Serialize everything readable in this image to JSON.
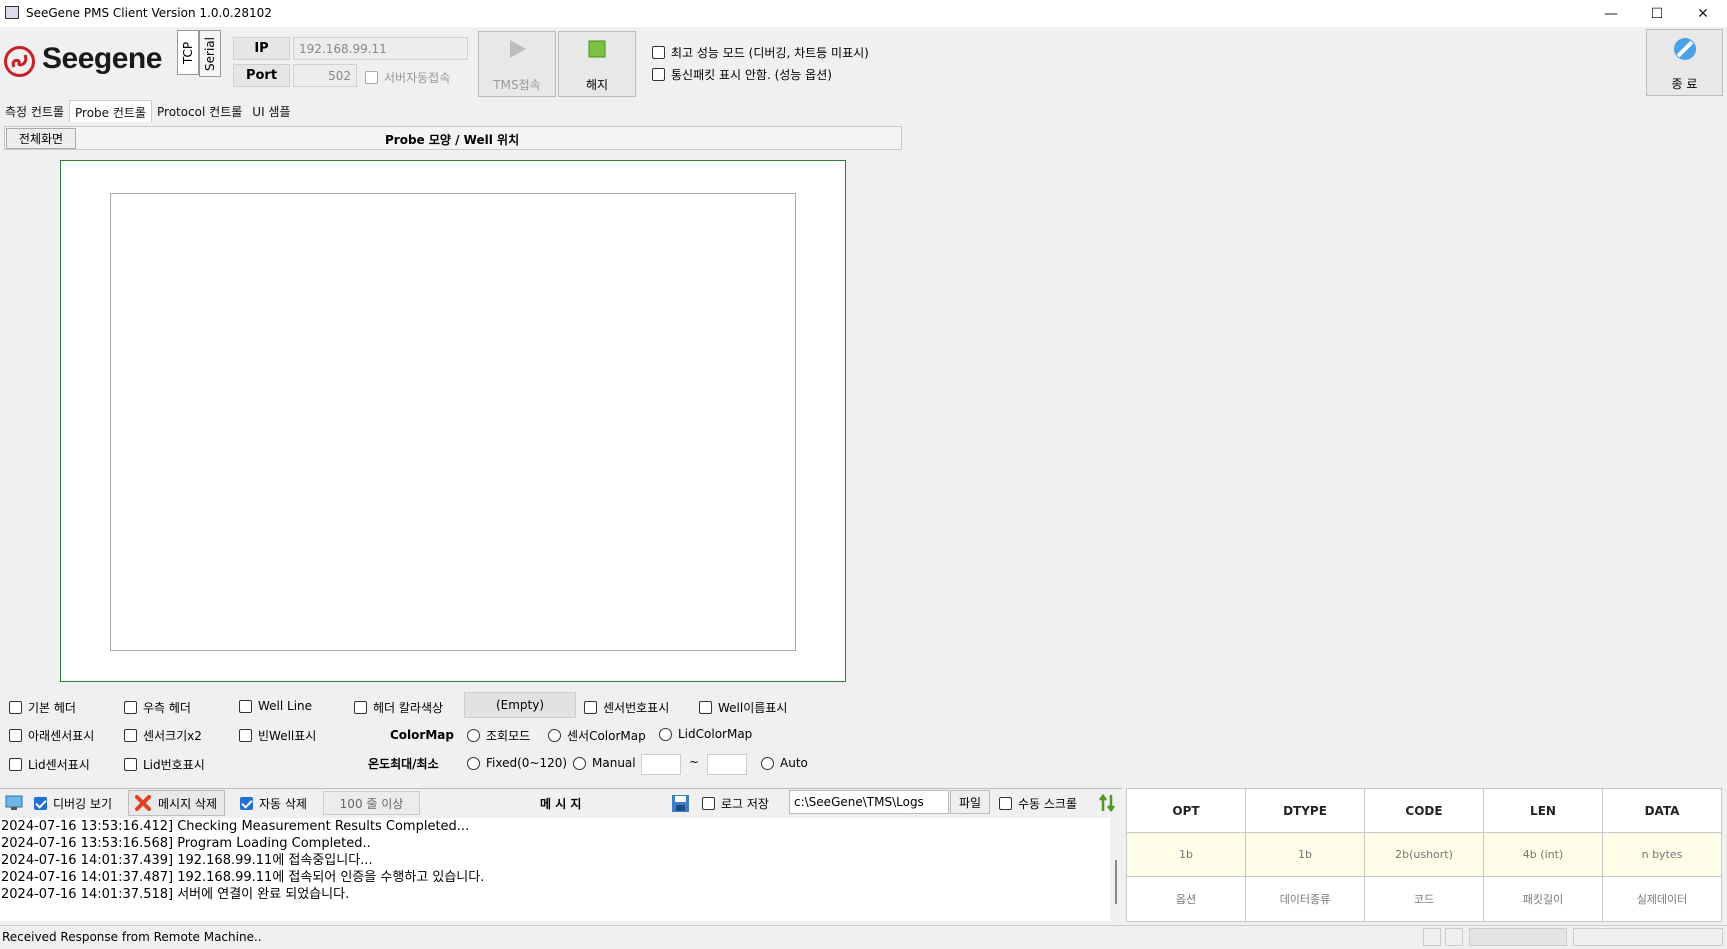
{
  "window": {
    "title": "SeeGene PMS Client Version 1.0.0.28102",
    "controls": [
      "—",
      "☐",
      "✕"
    ]
  },
  "toolbar": {
    "logo_text": "Seegene",
    "conn_tabs": [
      "TCP",
      "Serial"
    ],
    "ip_label": "IP",
    "ip_value": "192.168.99.11",
    "port_label": "Port",
    "port_value": "502",
    "auto_connect_label": "서버자동접속",
    "connect_label": "TMS접속",
    "disconnect_label": "해지",
    "max_perf_label": "최고 성능 모드 (디버깅, 차트등 미표시)",
    "hide_packet_label": "통신패킷 표시 안함. (성능 옵션)",
    "exit_label": "종 료"
  },
  "tabs": [
    "측정 컨트롤",
    "Probe 컨트롤",
    "Protocol 컨트롤",
    "UI 샘플"
  ],
  "probe": {
    "fullscreen_label": "전체화면",
    "title": "Probe 모양 / Well 위치",
    "options_row1": [
      "기본 헤더",
      "우측 헤더",
      "Well Line",
      "헤더 칼라색상"
    ],
    "empty_label": "(Empty)",
    "options_row1b": [
      "센서번호표시",
      "Well이름표시"
    ],
    "options_row2": [
      "아래센서표시",
      "센서크기x2",
      "빈Well표시"
    ],
    "colormap_label": "ColorMap",
    "colormap_options": [
      "조회모드",
      "센서ColorMap",
      "LidColorMap"
    ],
    "options_row3": [
      "Lid센서표시",
      "Lid번호표시"
    ],
    "temp_label": "온도최대/최소",
    "temp_options": [
      "Fixed(0~120)",
      "Manual"
    ],
    "tilde": "~",
    "auto_label": "Auto"
  },
  "log": {
    "debug_view_label": "디버깅 보기",
    "delete_msg_label": "메시지 삭제",
    "auto_delete_label": "자동 삭제",
    "lines_label": "100 줄 이상",
    "title": "메 시 지",
    "save_log_label": "로그 저장",
    "path_value": "c:\\SeeGene\\TMS\\Logs",
    "file_label": "파일",
    "manual_scroll_label": "수동 스크롤",
    "lines": [
      "2024-07-16 13:53:16.412] Checking Measurement Results Completed...",
      "2024-07-16 13:53:16.568] Program Loading Completed..",
      "2024-07-16 14:01:37.439] 192.168.99.11에 접속중입니다...",
      "2024-07-16 14:01:37.487] 192.168.99.11에 접속되어 인증을 수행하고 있습니다.",
      "2024-07-16 14:01:37.518] 서버에 연결이 완료 되었습니다."
    ]
  },
  "packet": {
    "headers": [
      "OPT",
      "DTYPE",
      "CODE",
      "LEN",
      "DATA"
    ],
    "types": [
      "1b",
      "1b",
      "2b(ushort)",
      "4b (int)",
      "n bytes"
    ],
    "names": [
      "옵션",
      "데이터종류",
      "코드",
      "패킷길이",
      "실제데이터"
    ]
  },
  "status": {
    "text": "Received Response from Remote Machine.."
  }
}
